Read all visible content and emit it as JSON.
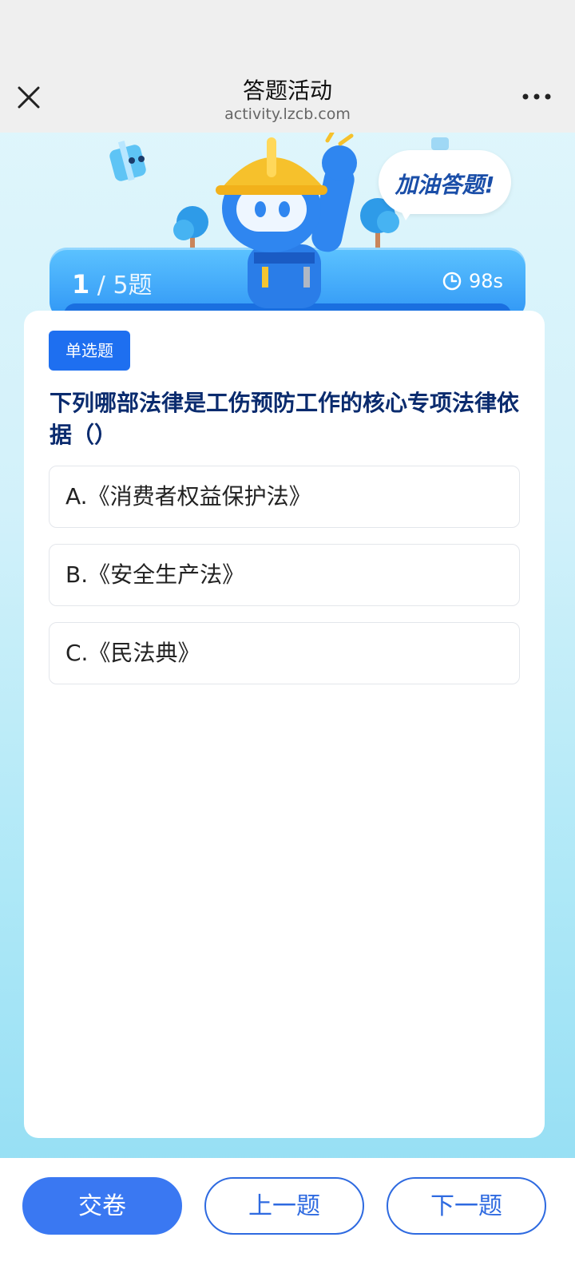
{
  "nav": {
    "title": "答题活动",
    "url": "activity.lzcb.com"
  },
  "hero": {
    "bubble_text": "加油答题!",
    "progress_current": "1",
    "progress_separator": " / ",
    "progress_total": "5题",
    "timer": "98s"
  },
  "question": {
    "type_label": "单选题",
    "text": "下列哪部法律是工伤预防工作的核心专项法律依据（）",
    "options": [
      {
        "label": "A.《消费者权益保护法》"
      },
      {
        "label": "B.《安全生产法》"
      },
      {
        "label": "C.《民法典》"
      }
    ]
  },
  "actions": {
    "submit": "交卷",
    "prev": "上一题",
    "next": "下一题"
  },
  "colors": {
    "primary": "#1e6ff0",
    "question_text": "#0a2b6e",
    "nav_bg": "#efefef"
  }
}
